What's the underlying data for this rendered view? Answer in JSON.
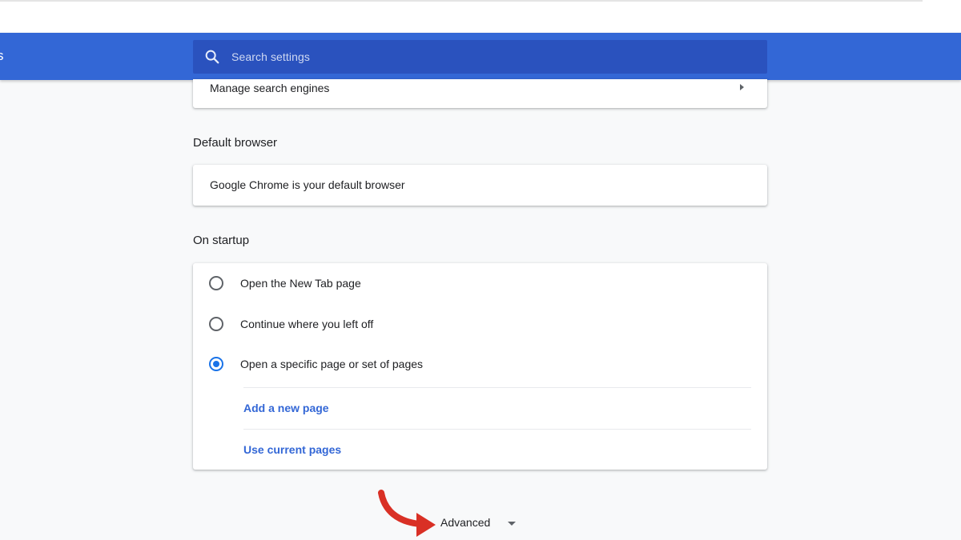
{
  "toolbar": {
    "edge_text": "s",
    "search_placeholder": "Search settings"
  },
  "search_engine": {
    "manage_label": "Manage search engines"
  },
  "default_browser": {
    "title": "Default browser",
    "status_text": "Google Chrome is your default browser"
  },
  "on_startup": {
    "title": "On startup",
    "options": [
      {
        "label": "Open the New Tab page",
        "selected": false
      },
      {
        "label": "Continue where you left off",
        "selected": false
      },
      {
        "label": "Open a specific page or set of pages",
        "selected": true
      }
    ],
    "add_page_label": "Add a new page",
    "use_current_label": "Use current pages"
  },
  "advanced": {
    "label": "Advanced"
  },
  "colors": {
    "toolbar": "#3367d6",
    "search_box": "#2a52be",
    "link": "#3367d6",
    "radio_checked": "#1a73e8",
    "annotation_arrow": "#d93025"
  },
  "icons": {
    "search": "search-icon",
    "submenu_arrow": "arrow-right-icon",
    "advanced_dropdown": "arrow-drop-down-icon",
    "annotation": "curved-arrow-annotation"
  }
}
